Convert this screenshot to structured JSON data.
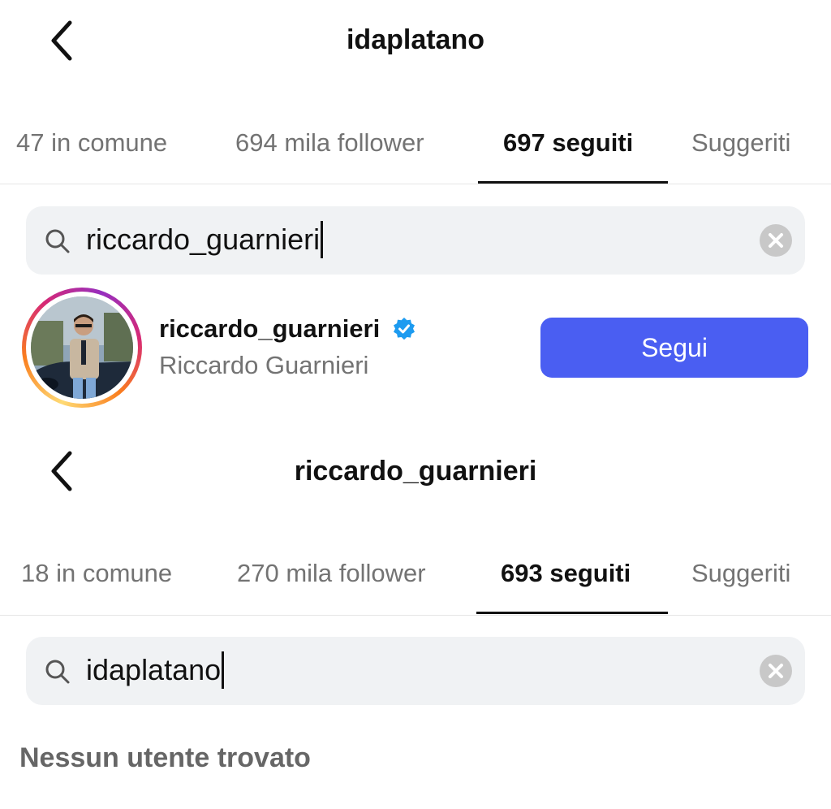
{
  "panel1": {
    "title": "idaplatano",
    "tabs": [
      "47 in comune",
      "694 mila follower",
      "697 seguiti",
      "Suggeriti"
    ],
    "active_tab": "697 seguiti",
    "search": {
      "value": "riccardo_guarnieri"
    },
    "result": {
      "username": "riccardo_guarnieri",
      "verified": true,
      "full_name": "Riccardo Guarnieri",
      "button_label": "Segui"
    }
  },
  "panel2": {
    "title": "riccardo_guarnieri",
    "tabs": [
      "18 in comune",
      "270 mila follower",
      "693 seguiti",
      "Suggeriti"
    ],
    "active_tab": "693 seguiti",
    "search": {
      "value": "idaplatano"
    },
    "empty_message": "Nessun utente trovato"
  },
  "icons": {
    "back": "chevron-left-icon",
    "search": "search-icon",
    "clear": "clear-circle-icon",
    "verified": "verified-badge-icon"
  },
  "colors": {
    "accent": "#4a5ef2",
    "verified": "#1d9bf0",
    "muted_text": "#737373"
  }
}
